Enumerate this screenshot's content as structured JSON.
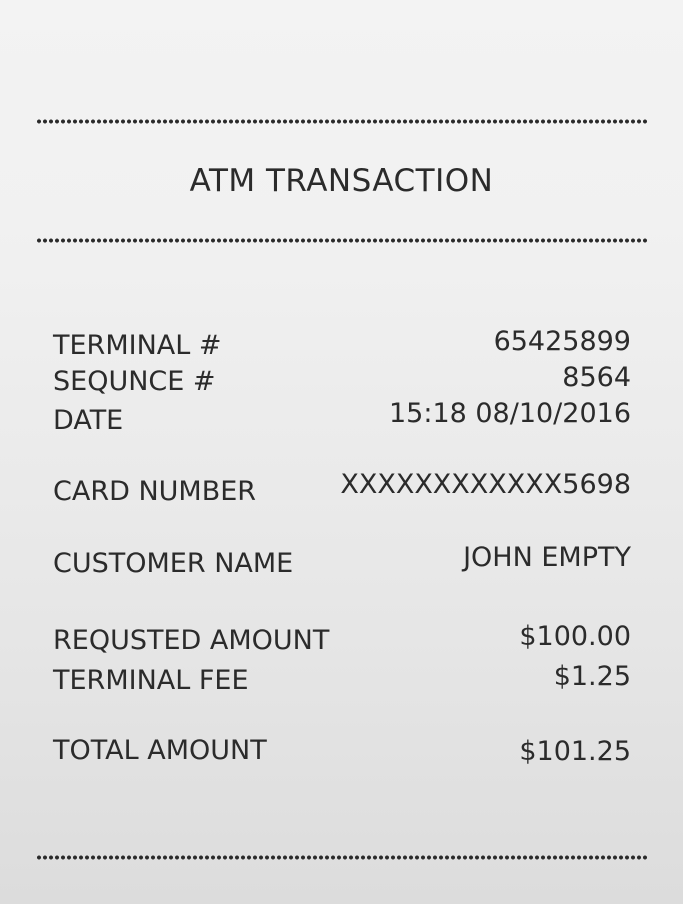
{
  "receipt": {
    "title": "ATM TRANSACTION",
    "rows": [
      {
        "label": "TERMINAL #",
        "value": "65425899"
      },
      {
        "label": "SEQUNCE #",
        "value": "8564"
      },
      {
        "label": "DATE",
        "value": "15:18 08/10/2016"
      },
      {
        "label": "CARD NUMBER",
        "value": "XXXXXXXXXXXX5698"
      },
      {
        "label": "CUSTOMER NAME",
        "value": "JOHN EMPTY"
      },
      {
        "label": "REQUSTED AMOUNT",
        "value": "$100.00"
      },
      {
        "label": "TERMINAL FEE",
        "value": "$1.25"
      },
      {
        "label": "TOTAL AMOUNT",
        "value": "$101.25"
      }
    ]
  }
}
